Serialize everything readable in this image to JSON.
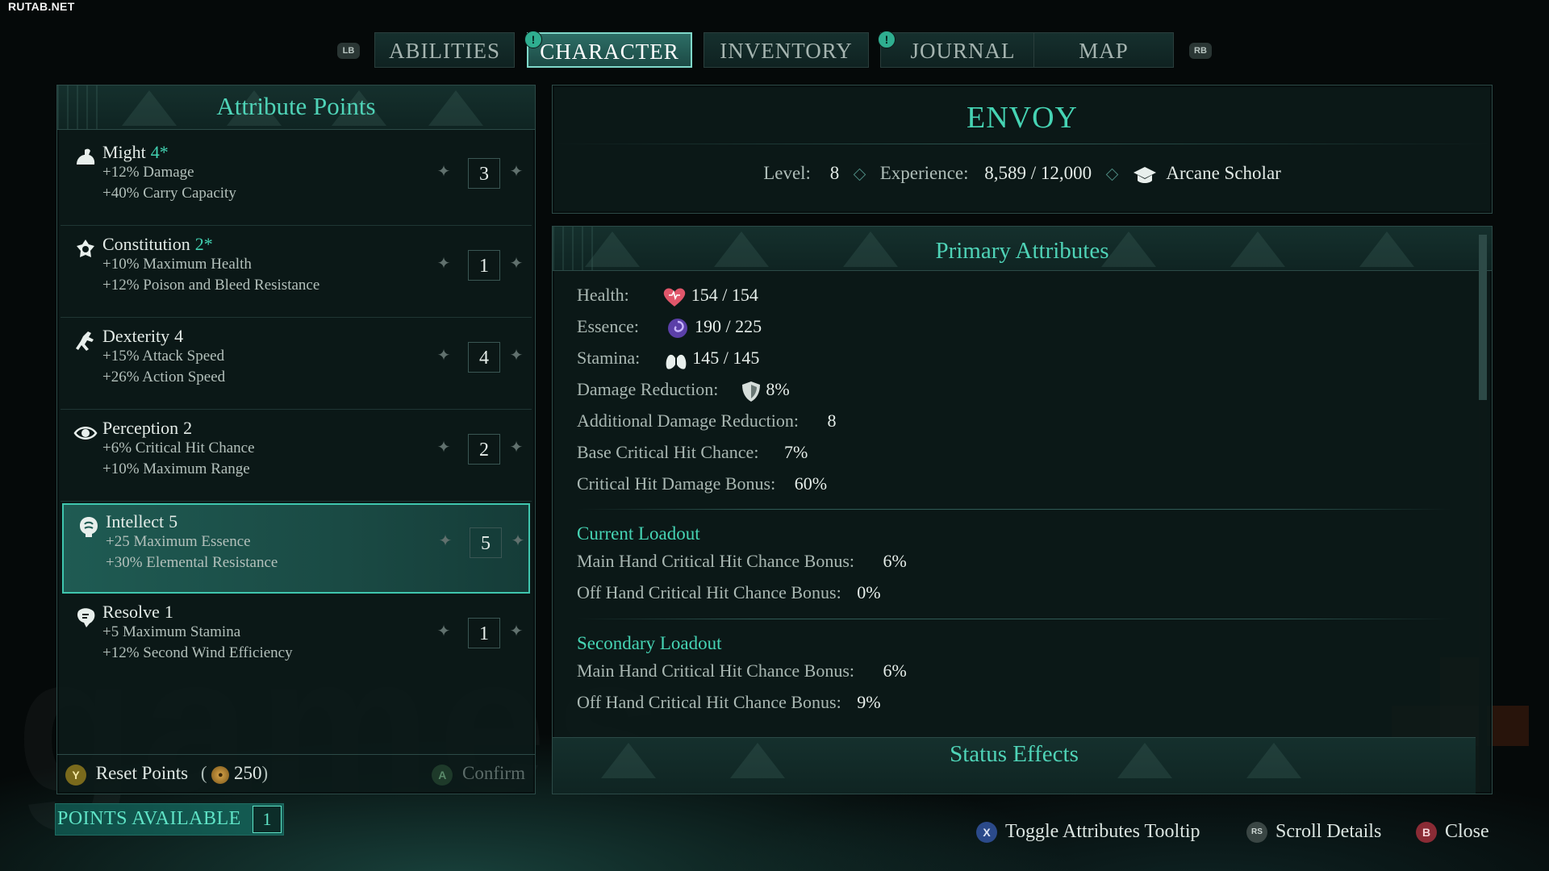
{
  "watermark": "RUTAB.NET",
  "nav": {
    "lb": "LB",
    "rb": "RB",
    "tabs": [
      {
        "label": "ABILITIES",
        "active": false,
        "alert": false
      },
      {
        "label": "CHARACTER",
        "active": true,
        "alert": true
      },
      {
        "label": "INVENTORY",
        "active": false,
        "alert": false
      },
      {
        "label": "JOURNAL",
        "active": false,
        "alert": true
      },
      {
        "label": "MAP",
        "active": false,
        "alert": false
      }
    ],
    "alert_glyph": "!"
  },
  "attribute_panel": {
    "title": "Attribute Points",
    "attributes": [
      {
        "name": "Might",
        "value": "4*",
        "value_highlight": true,
        "lines": [
          "+12% Damage",
          "+40% Carry Capacity"
        ],
        "allocated": "3",
        "icon": "might-icon"
      },
      {
        "name": "Constitution",
        "value": "2*",
        "value_highlight": true,
        "lines": [
          "+10% Maximum Health",
          "+12% Poison and Bleed Resistance"
        ],
        "allocated": "1",
        "icon": "constitution-icon"
      },
      {
        "name": "Dexterity",
        "value": "4",
        "value_highlight": false,
        "lines": [
          "+15% Attack Speed",
          "+26% Action Speed"
        ],
        "allocated": "4",
        "icon": "dexterity-icon"
      },
      {
        "name": "Perception",
        "value": "2",
        "value_highlight": false,
        "lines": [
          "+6% Critical Hit Chance",
          "+10% Maximum Range"
        ],
        "allocated": "2",
        "icon": "perception-icon"
      },
      {
        "name": "Intellect",
        "value": "5",
        "value_highlight": false,
        "lines": [
          "+25 Maximum Essence",
          "+30% Elemental Resistance"
        ],
        "allocated": "5",
        "icon": "intellect-icon",
        "selected": true
      },
      {
        "name": "Resolve",
        "value": "1",
        "value_highlight": false,
        "lines": [
          "+5 Maximum Stamina",
          "+12% Second Wind Efficiency"
        ],
        "allocated": "1",
        "icon": "resolve-icon"
      }
    ],
    "reset": {
      "button": "Y",
      "label": "Reset Points",
      "cost": "250"
    },
    "confirm": {
      "button": "A",
      "label": "Confirm"
    },
    "points_available": {
      "label": "POINTS AVAILABLE",
      "value": "1"
    }
  },
  "character": {
    "class_name": "ENVOY",
    "level_label": "Level:",
    "level": "8",
    "experience_label": "Experience:",
    "experience": "8,589 / 12,000",
    "background": "Arcane Scholar"
  },
  "primary_attributes": {
    "title": "Primary Attributes",
    "stats": [
      {
        "label": "Health:",
        "value": "154 / 154",
        "icon": "health-heart-icon"
      },
      {
        "label": "Essence:",
        "value": "190 / 225",
        "icon": "essence-swirl-icon"
      },
      {
        "label": "Stamina:",
        "value": "145 / 145",
        "icon": "stamina-lungs-icon"
      },
      {
        "label": "Damage Reduction:",
        "value": "8%",
        "icon": "shield-icon"
      },
      {
        "label": "Additional Damage Reduction:",
        "value": "8"
      },
      {
        "label": "Base Critical Hit Chance:",
        "value": "7%"
      },
      {
        "label": "Critical Hit Damage Bonus:",
        "value": "60%"
      }
    ],
    "current_loadout": {
      "title": "Current Loadout",
      "rows": [
        {
          "label": "Main Hand Critical Hit Chance Bonus:",
          "value": "6%"
        },
        {
          "label": "Off Hand Critical Hit Chance Bonus:",
          "value": "0%"
        }
      ]
    },
    "secondary_loadout": {
      "title": "Secondary Loadout",
      "rows": [
        {
          "label": "Main Hand Critical Hit Chance Bonus:",
          "value": "6%"
        },
        {
          "label": "Off Hand Critical Hit Chance Bonus:",
          "value": "9%"
        }
      ]
    },
    "status_effects_title": "Status Effects"
  },
  "footer": {
    "hints": [
      {
        "button": "X",
        "label": "Toggle Attributes Tooltip",
        "color": "#2b4a8a"
      },
      {
        "button": "RS",
        "label": "Scroll Details",
        "color": "#3a4644"
      },
      {
        "button": "B",
        "label": "Close",
        "color": "#8a2b35"
      }
    ]
  },
  "colors": {
    "accent": "#46d4b4",
    "panel_bg": "#0c1a19",
    "selected_bg": "#1f5b53",
    "active_tab_border": "#7fd8c9"
  }
}
